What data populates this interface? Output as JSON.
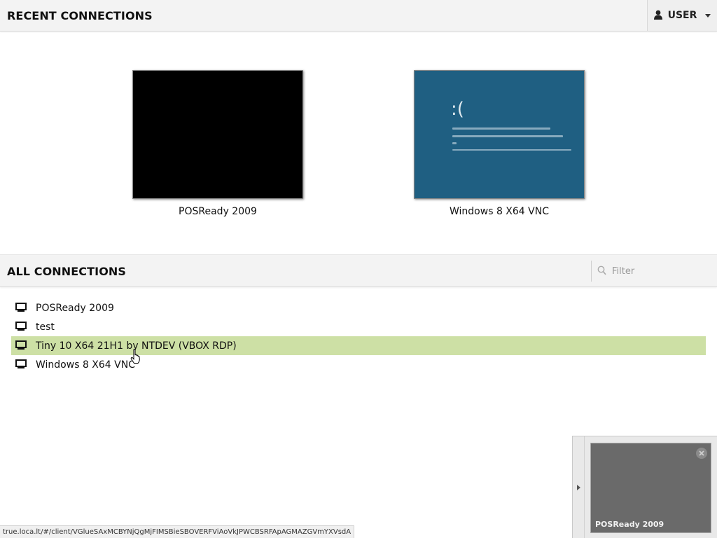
{
  "header": {
    "recent_title": "RECENT CONNECTIONS",
    "user_label": "USER"
  },
  "recent": [
    {
      "name": "POSReady 2009",
      "screen": "black"
    },
    {
      "name": "Windows 8 X64 VNC",
      "screen": "bsod",
      "bsod_face": ":("
    }
  ],
  "all": {
    "title": "ALL CONNECTIONS",
    "filter_placeholder": "Filter",
    "connections": [
      {
        "name": "POSReady 2009"
      },
      {
        "name": "test"
      },
      {
        "name": "Tiny 10 X64 21H1 by NTDEV (VBOX RDP)",
        "hovered": true
      },
      {
        "name": "Windows 8 X64 VNC"
      }
    ]
  },
  "status_url": "true.loca.lt/#/client/VGlueSAxMCBYNjQgMjFIMSBieSBOVERFViAoVkJPWCBSRFApAGMAZGVmYXVsdA",
  "active_session": {
    "name": "POSReady 2009"
  },
  "colors": {
    "highlight_row": "#cde0a5",
    "bsod_blue": "#1f5f82",
    "header_bg": "#f3f3f3"
  },
  "icons": {
    "user": "user-icon",
    "search": "search-icon",
    "connection": "monitor-icon",
    "close": "close-icon",
    "expand": "chevron-right-icon"
  }
}
